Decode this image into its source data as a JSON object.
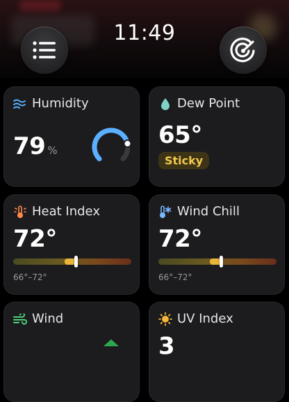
{
  "status": {
    "time": "11:49"
  },
  "header": {
    "menu_icon": "list-icon",
    "radar_icon": "radar-icon"
  },
  "cards": {
    "humidity": {
      "title": "Humidity",
      "icon": "humidity-icon",
      "value": "79",
      "unit": "%",
      "gauge_fraction": 0.79,
      "color": "#5ab0ff"
    },
    "dew_point": {
      "title": "Dew Point",
      "icon": "droplet-icon",
      "value": "65°",
      "badge": "Sticky",
      "badge_color": "#f2c94c"
    },
    "heat_index": {
      "title": "Heat Index",
      "icon": "thermometer-sun-icon",
      "value": "72°",
      "range_label": "66°–72°",
      "bar_low": 66,
      "bar_high": 72,
      "bar_marker": 72
    },
    "wind_chill": {
      "title": "Wind Chill",
      "icon": "thermometer-snow-icon",
      "value": "72°",
      "range_label": "66°–72°",
      "bar_low": 66,
      "bar_high": 72,
      "bar_marker": 72
    },
    "wind": {
      "title": "Wind",
      "icon": "wind-icon"
    },
    "uv_index": {
      "title": "UV Index",
      "icon": "sun-icon",
      "value": "3"
    }
  },
  "colors": {
    "background": "#000000",
    "card": "#1c1c1e",
    "accent_blue": "#5ab0ff",
    "accent_yellow": "#e8b43a"
  }
}
